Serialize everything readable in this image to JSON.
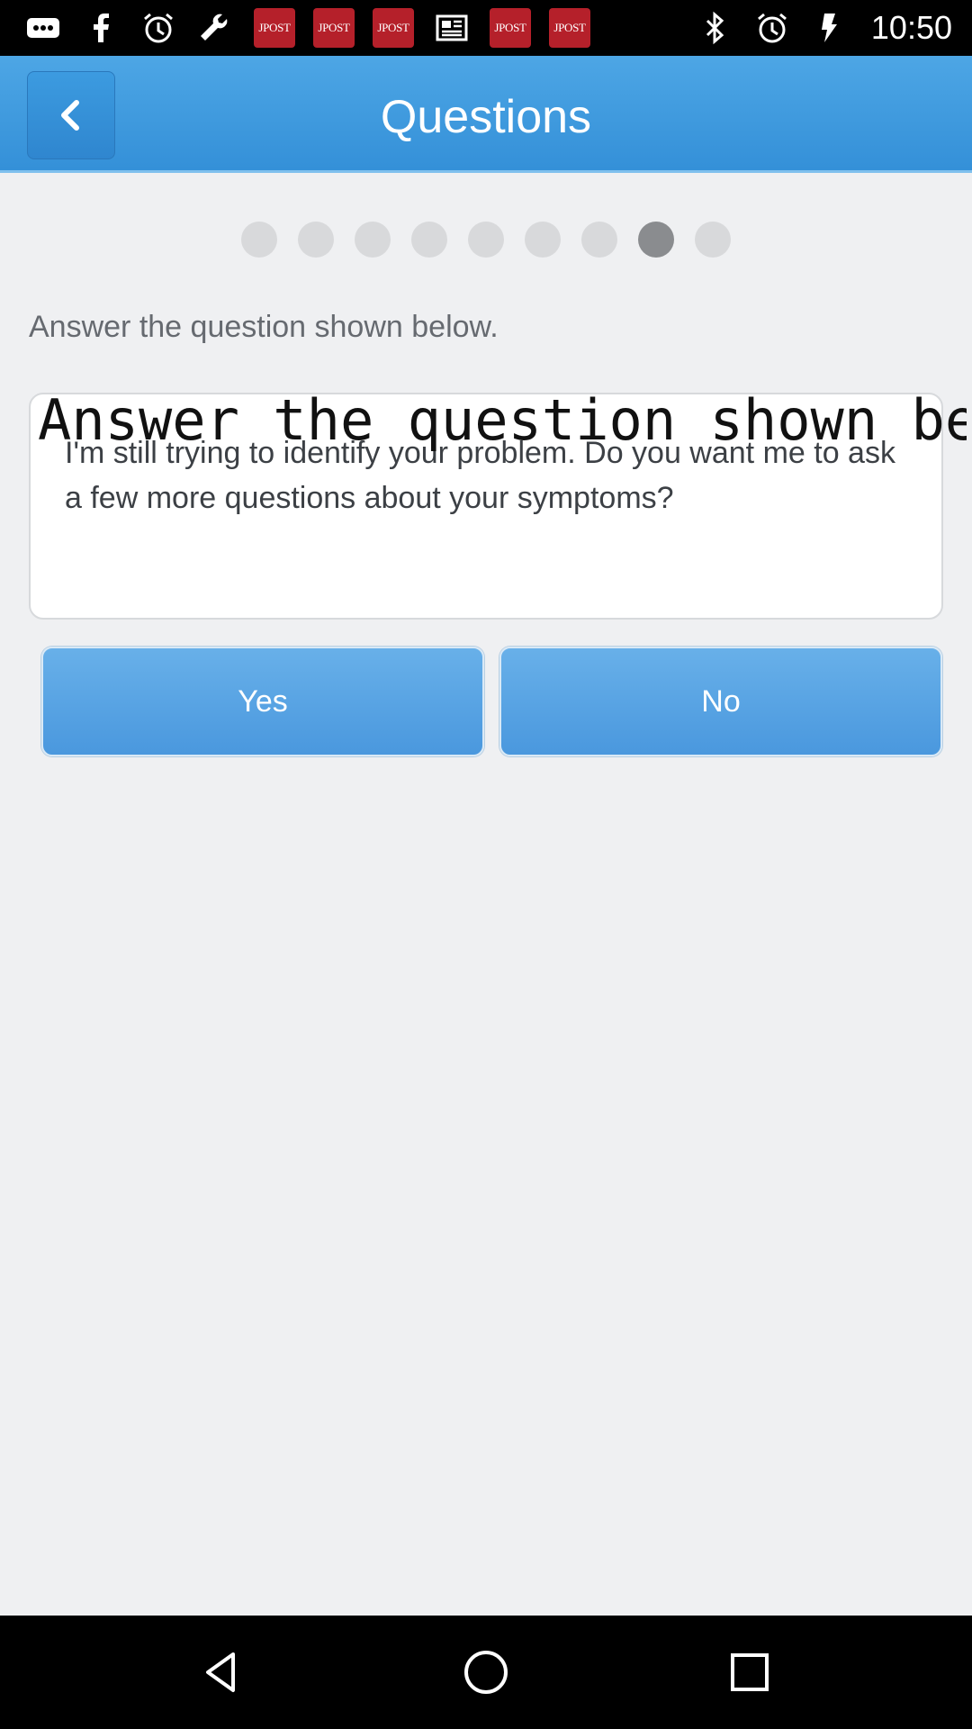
{
  "status_bar": {
    "time": "10:50",
    "jpost_label": "JPOST",
    "left_icons": [
      "more-icon",
      "facebook-icon",
      "alarm-icon",
      "wrench-icon",
      "jpost-icon",
      "jpost-icon",
      "jpost-icon",
      "news-icon",
      "jpost-icon",
      "jpost-icon"
    ],
    "right_icons": [
      "bluetooth-icon",
      "alarm-icon",
      "signal-icon"
    ]
  },
  "header": {
    "title": "Questions",
    "back_icon": "chevron-left-icon",
    "color": "#3c9be0"
  },
  "progress": {
    "total": 9,
    "current": 8
  },
  "instruction": "Answer the question shown below.",
  "question": {
    "overlay_text": "Answer the question shown be",
    "text": "I'm still trying to identify your problem. Do you want me to ask a few more questions about your symptoms?"
  },
  "answers": {
    "yes_label": "Yes",
    "no_label": "No"
  },
  "nav": {
    "icons": [
      "back-triangle-icon",
      "home-circle-icon",
      "recents-square-icon"
    ]
  }
}
